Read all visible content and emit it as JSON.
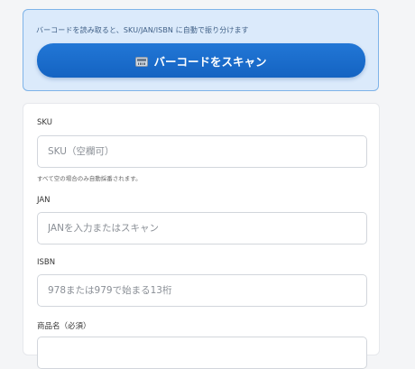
{
  "scanner": {
    "hint": "バーコードを読み取ると、SKU/JAN/ISBN に自動で振り分けます",
    "button_label": "バーコードをスキャン",
    "button_icon": "barcode-scanner-icon"
  },
  "form": {
    "sku": {
      "label": "SKU",
      "placeholder": "SKU（空欄可）",
      "help": "すべて空の場合のみ自動採番されます。"
    },
    "jan": {
      "label": "JAN",
      "placeholder": "JANを入力またはスキャン"
    },
    "isbn": {
      "label": "ISBN",
      "placeholder": "978または979で始まる13桁"
    },
    "product_name": {
      "label": "商品名（必須）"
    }
  }
}
